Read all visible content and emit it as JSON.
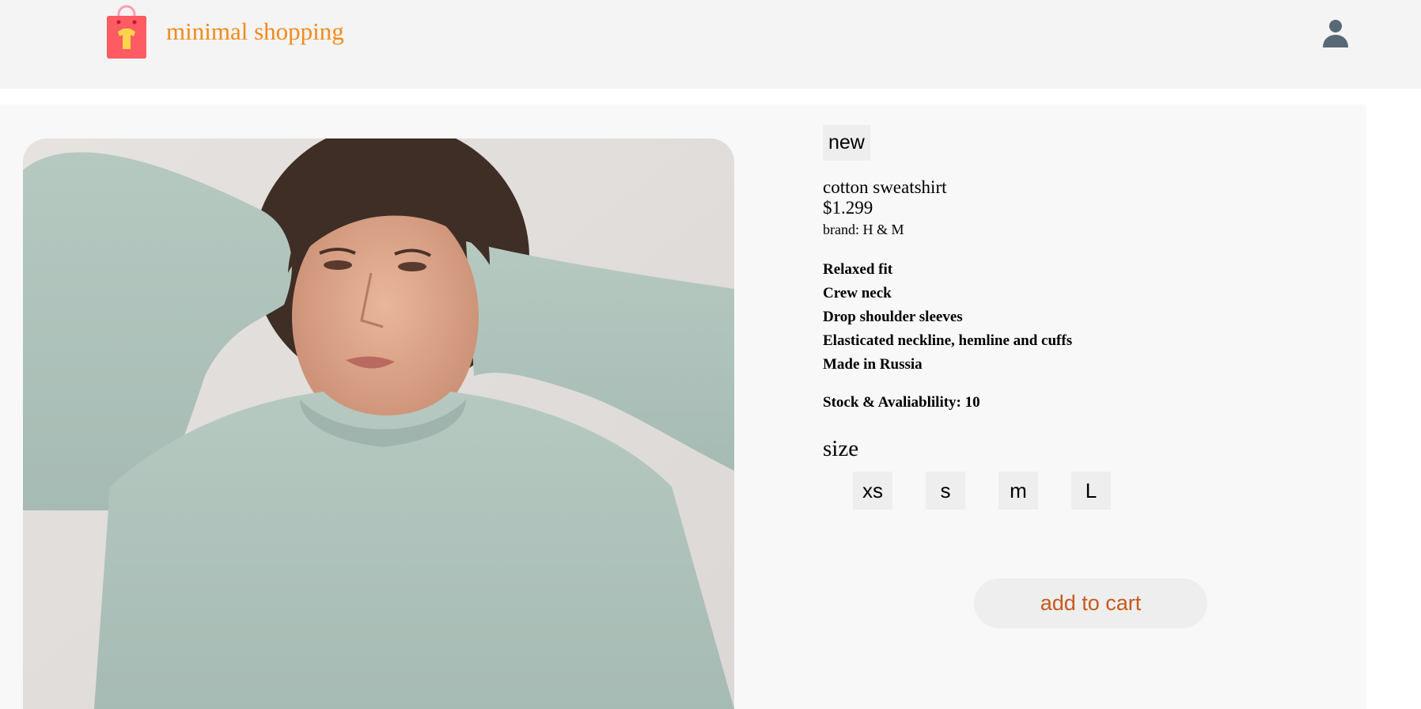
{
  "header": {
    "site_name": "minimal shopping",
    "brand_color": "#f28a1c",
    "logo_icon": "shopping-bag-shirt-icon",
    "user_icon": "user-icon"
  },
  "product": {
    "badge": "new",
    "name": "cotton sweatshirt",
    "price": "$1.299",
    "brand": "brand: H & M",
    "features": [
      "Relaxed fit",
      "Crew neck",
      "Drop shoulder sleeves",
      "Elasticated neckline, hemline and cuffs",
      "Made in Russia"
    ],
    "stock": "Stock & Avaliablility: 10",
    "size_title": "size",
    "sizes": [
      "xs",
      "s",
      "m",
      "L"
    ],
    "add_to_cart": "add to cart",
    "cart_color": "#c8581a"
  }
}
